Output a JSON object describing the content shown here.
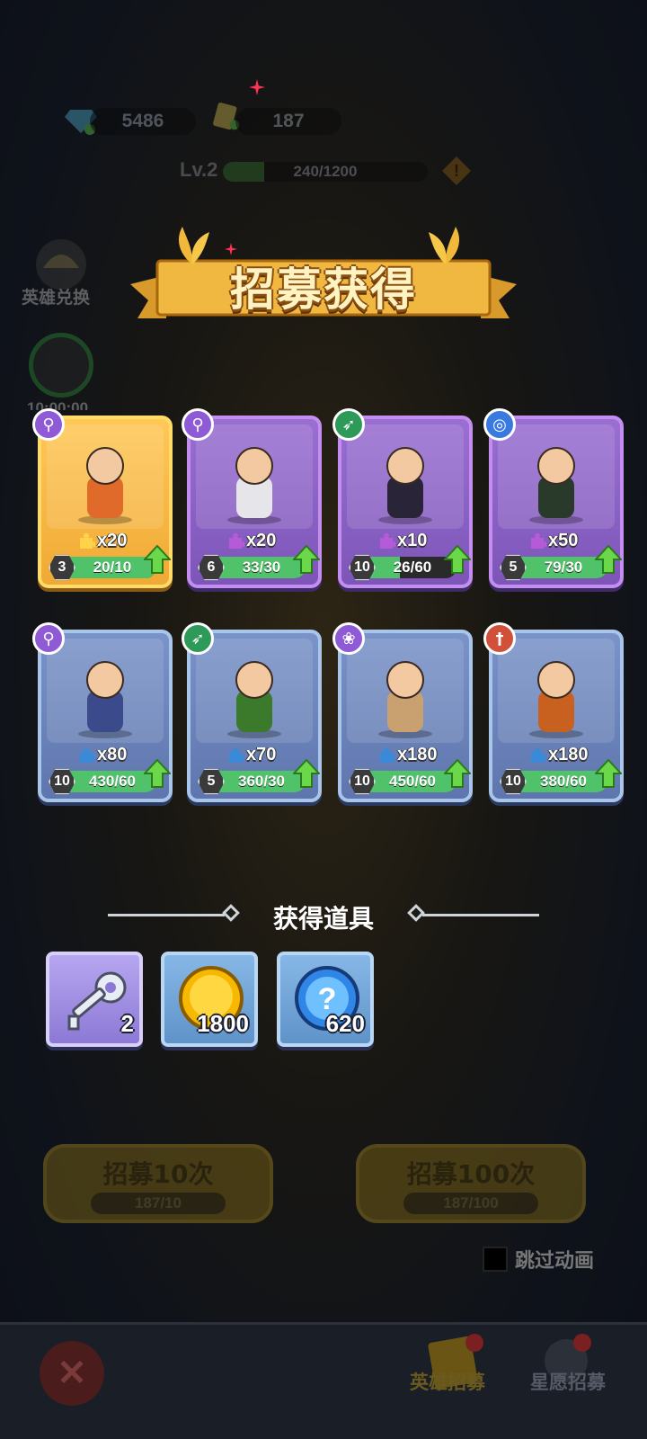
{
  "resources": {
    "gems": "5486",
    "tickets": "187"
  },
  "player": {
    "level_label": "Lv.2",
    "xp_text": "240/1200",
    "xp_progress": 0.2
  },
  "side_menu": {
    "hero_exchange_label": "英雄兑换",
    "timer_label": "10:00:00"
  },
  "banner": {
    "title": "招募获得"
  },
  "heroes": [
    {
      "rarity": "legendary",
      "class_icon": "mage-staff-icon",
      "shards": "x20",
      "level": "3",
      "progress": "20/10",
      "fill": 1.0
    },
    {
      "rarity": "epic",
      "class_icon": "mage-staff-icon",
      "shards": "x20",
      "level": "6",
      "progress": "33/30",
      "fill": 1.0
    },
    {
      "rarity": "epic",
      "class_icon": "bow-icon",
      "shards": "x10",
      "level": "10",
      "progress": "26/60",
      "fill": 0.43
    },
    {
      "rarity": "epic",
      "class_icon": "swirl-icon",
      "shards": "x50",
      "level": "5",
      "progress": "79/30",
      "fill": 1.0
    },
    {
      "rarity": "rare",
      "class_icon": "mage-staff-icon",
      "shards": "x80",
      "level": "10",
      "progress": "430/60",
      "fill": 1.0
    },
    {
      "rarity": "rare",
      "class_icon": "bow-icon",
      "shards": "x70",
      "level": "5",
      "progress": "360/30",
      "fill": 1.0
    },
    {
      "rarity": "rare",
      "class_icon": "paw-icon",
      "shards": "x180",
      "level": "10",
      "progress": "450/60",
      "fill": 1.0
    },
    {
      "rarity": "rare",
      "class_icon": "sword-icon",
      "shards": "x180",
      "level": "10",
      "progress": "380/60",
      "fill": 1.0
    }
  ],
  "items_section": {
    "title": "获得道具",
    "items": [
      {
        "icon": "key-icon",
        "quantity": "2"
      },
      {
        "icon": "gold-coin-icon",
        "quantity": "1800"
      },
      {
        "icon": "blue-mystery-orb-icon",
        "quantity": "620"
      }
    ]
  },
  "recruit": {
    "ten_label": "招募10次",
    "ten_cost": "187/10",
    "hundred_label": "招募100次",
    "hundred_cost": "187/100",
    "skip_label": "跳过动画"
  },
  "nav": {
    "hero_recruit": "英雄招募",
    "wish_recruit": "星愿招募"
  },
  "colors": {
    "epic_card": "#9a6fd2",
    "rare_card": "#7a93c8",
    "legendary_card": "#ffc857",
    "progress_green": "#4fc26a"
  }
}
